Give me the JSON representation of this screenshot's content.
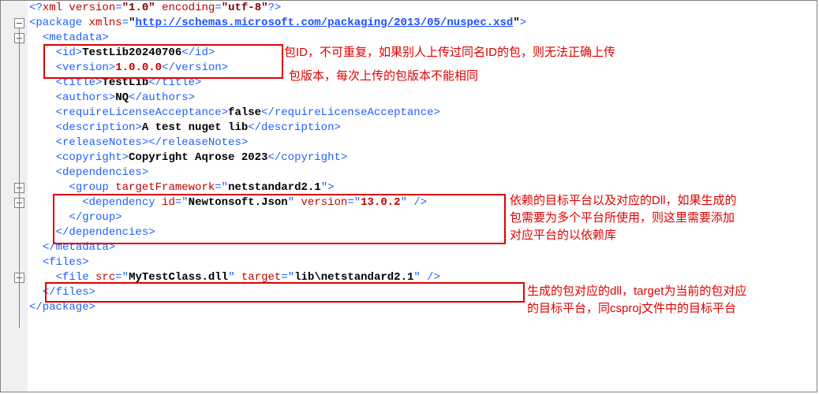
{
  "xml_decl": {
    "version_attr": "version",
    "version_val": "\"1.0\"",
    "enc_attr": "encoding",
    "enc_val": "\"utf-8\""
  },
  "pkg": {
    "ns_attr": "xmlns",
    "ns_val": "\"",
    "ns_url": "http://schemas.microsoft.com/packaging/2013/05/nuspec.xsd",
    "ns_close": "\""
  },
  "metadata_open": "<metadata>",
  "id": {
    "open": "<id>",
    "text": "TestLib20240706",
    "close": "</id>"
  },
  "version": {
    "open": "<version>",
    "text": "1.0.0.0",
    "close": "</version>"
  },
  "title": {
    "open": "<title>",
    "text": "TestLib",
    "close": "</title>"
  },
  "authors": {
    "open": "<authors>",
    "text": "NQ",
    "close": "</authors>"
  },
  "rla": {
    "open": "<requireLicenseAcceptance>",
    "text": "false",
    "close": "</requireLicenseAcceptance>"
  },
  "desc": {
    "open": "<description>",
    "text": "A test nuget lib",
    "close": "</description>"
  },
  "rel": {
    "text": "<releaseNotes></releaseNotes>"
  },
  "copy": {
    "open": "<copyright>",
    "text": "Copyright Aqrose 2023",
    "close": "</copyright>"
  },
  "deps_open": "<dependencies>",
  "group": {
    "open_tag": "<group ",
    "tf_attr": "targetFramework",
    "eq": "=\"",
    "tf_val": "netstandard2.1",
    "close": "\">"
  },
  "dep": {
    "open": "<dependency ",
    "id_attr": "id",
    "id_val": "Newtonsoft.Json",
    "ver_attr": "version",
    "ver_val": "13.0.2",
    "close": " />"
  },
  "group_close": "</group>",
  "deps_close": "</dependencies>",
  "metadata_close": "</metadata>",
  "files_open": "<files>",
  "file": {
    "open": "<file ",
    "src_attr": "src",
    "src_val": "MyTestClass.dll",
    "tgt_attr": "target",
    "tgt_val": "lib\\netstandard2.1",
    "close": " />"
  },
  "files_close": "</files>",
  "pkg_close": "</package>",
  "annotations": {
    "id_note": "包ID，不可重复，如果别人上传过同名ID的包，则无法正确上传",
    "ver_note": "包版本，每次上传的包版本不能相同",
    "dep_note_l1": "依赖的目标平台以及对应的Dll，如果生成的",
    "dep_note_l2": "包需要为多个平台所使用，则这里需要添加",
    "dep_note_l3": "对应平台的以依赖库",
    "file_note_l1": "生成的包对应的dll，target为当前的包对应",
    "file_note_l2": "的目标平台，同csproj文件中的目标平台"
  },
  "chart_data": null
}
